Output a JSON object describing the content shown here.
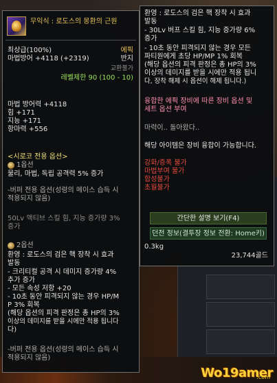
{
  "left_tooltip": {
    "item_name": "무익식 : 로도스의 몽환의 근원",
    "grade": "최상급(100%)",
    "rarity": "에픽",
    "defense_line": "마법방어 +4118 (+2319)",
    "slot": "반지",
    "trade": "교환불가",
    "level_limit": "레벨제한 90 (100 - 10)",
    "stats": [
      "마법 방어력 +4118",
      "힘 +171",
      "지능 +171",
      "항마력 +556"
    ],
    "exclusive_header": "<시로코 전용 옵션>",
    "option1_label": "1옵션",
    "option1_lines": [
      "물리, 마법, 독립 공격력 5% 증가"
    ],
    "option1_note": [
      "-버퍼 전용 옵션(성령의 메이스 습득 시",
      "적용되지 않음)"
    ],
    "option1_extra": [
      "50Lv 액티브 스킬 힘, 지능 증가량 3%",
      "증가"
    ],
    "option2_label": "2옵션",
    "option2_lines": [
      "환영 : 로도스의 검은 핵 장착 시 효과",
      "발동",
      "- 크리티컬 공격 시 데미지 증가량 4%",
      "추가 증가",
      "- 모든 속성 저항 +20",
      "- 10초 동안 피격되지 않는 경우 HP/M",
      "P 3% 회복",
      "(해당 옵션의 피격 판정은 총 HP의 3%",
      "이상의 데미지를 받을 시에만 적용 됩니다",
      "다)"
    ],
    "option2_note": [
      "-버퍼 전용 옵션(성령의 메이스 습득 시",
      "적용되지 않음)"
    ]
  },
  "right_tooltip": {
    "top_lines": [
      "환영 : 로도스의 검은 핵 장착 시 효과",
      "발동",
      "- 30Lv 버프 스킬 힘, 지능 증가량 6%",
      "증가",
      "- 10초 동안 피격되지 않는 경우 모든",
      "파티원에게 초당 HP/MP 1% 회복",
      "(해당 옵션의 피격 판정은 총 HP의 3%",
      "이상의 데미지를 받을 시에만 적용 됩니",
      "다, 장착 해제 시 옵션이 해제 됩니다.)"
    ],
    "fusion_lines": [
      "융합한 에픽 장비에 따른 장비 옵션 및",
      "세트 옵션 부여"
    ],
    "flavor": "마력이.. 돌아왔다..",
    "fusion_possible": "해당 아이템은 장비 융합이 가능합니다.",
    "restrictions": [
      "강화/증폭 불가",
      "마법부여 불가",
      "합성불가",
      "초월불가"
    ],
    "summary_button": "간단한 설명 보기(F4)",
    "dungeon_button": "던전 정보(결투장 정보 전환: Home키)",
    "weight": "0.3kg",
    "price": "23,744골드"
  },
  "watermark": "Wo19amer",
  "watermark_sub": ".com"
}
